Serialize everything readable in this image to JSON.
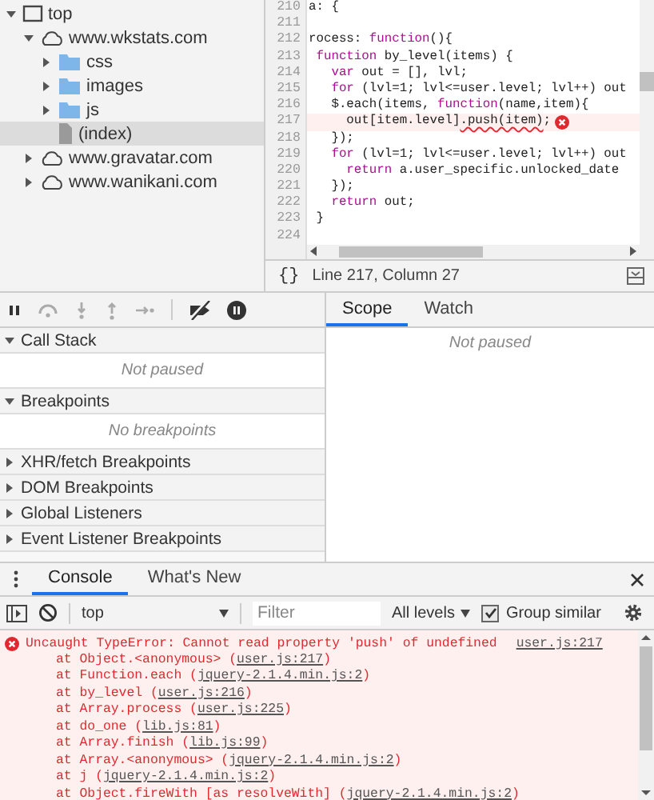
{
  "tree": [
    {
      "label": "top",
      "kind": "frame",
      "expanded": true,
      "selected": false,
      "children": [
        {
          "label": "www.wkstats.com",
          "kind": "cloud",
          "expanded": true,
          "selected": false,
          "children": [
            {
              "label": "css",
              "kind": "folder",
              "expanded": false,
              "selected": false
            },
            {
              "label": "images",
              "kind": "folder",
              "expanded": false,
              "selected": false
            },
            {
              "label": "js",
              "kind": "folder",
              "expanded": false,
              "selected": false
            },
            {
              "label": "(index)",
              "kind": "file",
              "selected": true
            }
          ]
        },
        {
          "label": "www.gravatar.com",
          "kind": "cloud",
          "expanded": false,
          "selected": false
        },
        {
          "label": "www.wanikani.com",
          "kind": "cloud",
          "expanded": false,
          "selected": false
        }
      ]
    }
  ],
  "editor": {
    "lines": [
      {
        "num": "210",
        "error": false,
        "tokens": [
          {
            "t": "a: {",
            "kind": "plain"
          }
        ]
      },
      {
        "num": "211",
        "error": false
      },
      {
        "num": "212",
        "error": false,
        "tokens": [
          {
            "t": "rocess: ",
            "kind": "plain"
          },
          {
            "t": "function",
            "kind": "keyword"
          },
          {
            "t": "(){",
            "kind": "plain"
          }
        ]
      },
      {
        "num": "213",
        "error": false,
        "tokens": [
          {
            "t": " function",
            "kind": "keyword"
          },
          {
            "t": " by_level(items) {",
            "kind": "plain"
          }
        ]
      },
      {
        "num": "214",
        "error": false,
        "tokens": [
          {
            "t": "   var",
            "kind": "keyword"
          },
          {
            "t": " out = [], lvl;",
            "kind": "plain"
          }
        ]
      },
      {
        "num": "215",
        "error": false,
        "tokens": [
          {
            "t": "   for",
            "kind": "keyword"
          },
          {
            "t": " (lvl=1; lvl<=user.level; lvl++) out",
            "kind": "plain"
          }
        ]
      },
      {
        "num": "216",
        "error": false,
        "tokens": [
          {
            "t": "   $.each(items, ",
            "kind": "plain"
          },
          {
            "t": "function",
            "kind": "keyword"
          },
          {
            "t": "(name,item){",
            "kind": "plain"
          }
        ]
      },
      {
        "num": "217",
        "error": true,
        "tokens": [
          {
            "t": "     out[item.level]",
            "kind": "plain"
          },
          {
            "t": ".push(item)",
            "kind": "squiggle"
          },
          {
            "t": ";",
            "kind": "plain"
          }
        ]
      },
      {
        "num": "218",
        "error": false,
        "tokens": [
          {
            "t": "   });",
            "kind": "plain"
          }
        ]
      },
      {
        "num": "219",
        "error": false,
        "tokens": [
          {
            "t": "   for",
            "kind": "keyword"
          },
          {
            "t": " (lvl=1; lvl<=user.level; lvl++) out",
            "kind": "plain"
          }
        ]
      },
      {
        "num": "220",
        "error": false,
        "tokens": [
          {
            "t": "     return",
            "kind": "keyword"
          },
          {
            "t": " a.user_specific.unlocked_date",
            "kind": "plain"
          }
        ]
      },
      {
        "num": "221",
        "error": false,
        "tokens": [
          {
            "t": "   });",
            "kind": "plain"
          }
        ]
      },
      {
        "num": "222",
        "error": false,
        "tokens": [
          {
            "t": "   return",
            "kind": "keyword"
          },
          {
            "t": " out;",
            "kind": "plain"
          }
        ]
      },
      {
        "num": "223",
        "error": false,
        "tokens": [
          {
            "t": " }",
            "kind": "plain"
          }
        ]
      },
      {
        "num": "224",
        "error": false
      }
    ],
    "format_button": "{}",
    "status": "Line 217, Column 27"
  },
  "sections": [
    {
      "title": "Call Stack",
      "expanded": true,
      "body": "Not paused"
    },
    {
      "title": "Breakpoints",
      "expanded": true,
      "body": "No breakpoints"
    },
    {
      "title": "XHR/fetch Breakpoints",
      "expanded": false
    },
    {
      "title": "DOM Breakpoints",
      "expanded": false
    },
    {
      "title": "Global Listeners",
      "expanded": false
    },
    {
      "title": "Event Listener Breakpoints",
      "expanded": false
    }
  ],
  "side_tabs": [
    {
      "label": "Scope",
      "selected": true
    },
    {
      "label": "Watch",
      "selected": false
    }
  ],
  "side_body": "Not paused",
  "drawer_tabs": [
    {
      "label": "Console",
      "selected": true
    },
    {
      "label": "What's New",
      "selected": false
    }
  ],
  "console": {
    "context": "top",
    "filter_placeholder": "Filter",
    "levels": "All levels",
    "group_similar": {
      "label": "Group similar",
      "checked": true
    },
    "error": {
      "message": "Uncaught TypeError: Cannot read property 'push' of undefined",
      "source": "user.js:217",
      "stack": [
        {
          "before": "at Object.<anonymous> (",
          "link": "user.js:217",
          "after": ")"
        },
        {
          "before": "at Function.each (",
          "link": "jquery-2.1.4.min.js:2",
          "after": ")"
        },
        {
          "before": "at by_level (",
          "link": "user.js:216",
          "after": ")"
        },
        {
          "before": "at Array.process (",
          "link": "user.js:225",
          "after": ")"
        },
        {
          "before": "at do_one (",
          "link": "lib.js:81",
          "after": ")"
        },
        {
          "before": "at Array.finish (",
          "link": "lib.js:99",
          "after": ")"
        },
        {
          "before": "at Array.<anonymous> (",
          "link": "jquery-2.1.4.min.js:2",
          "after": ")"
        },
        {
          "before": "at j (",
          "link": "jquery-2.1.4.min.js:2",
          "after": ")"
        },
        {
          "before": "at Object.fireWith [as resolveWith] (",
          "link": "jquery-2.1.4.min.js:2",
          "after": ")"
        }
      ]
    }
  }
}
